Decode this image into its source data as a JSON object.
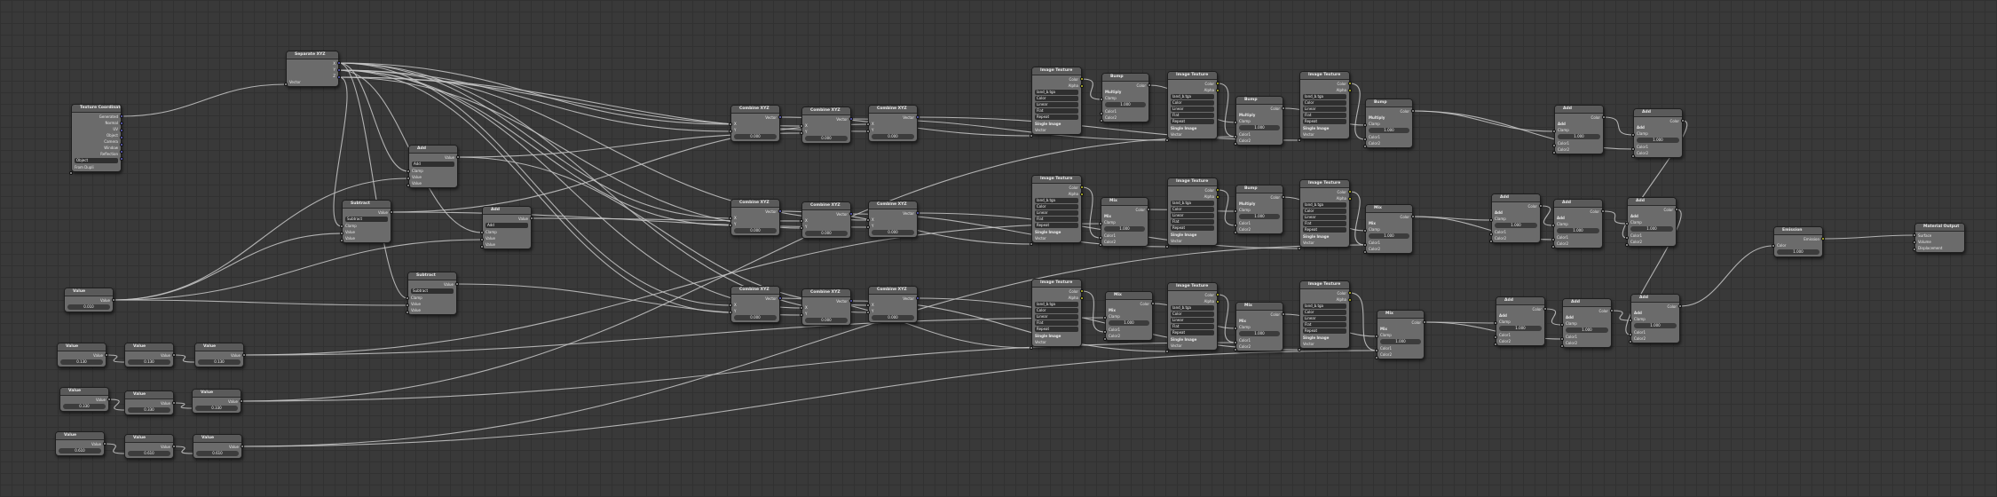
{
  "node_editor": {
    "colors": {
      "background": "#393939",
      "grid": "#313131",
      "wire": "#c8c8c8",
      "node_body": "#6b6b6b",
      "node_header": "#5a5a5a",
      "socket_vector": "#6363c7",
      "socket_color": "#c7c729",
      "socket_float": "#a1a1a1"
    },
    "labels": {
      "texcoord": "Texture Coordinate",
      "sepxyz": "Separate XYZ",
      "combxyz": "Combine XYZ",
      "imgtex": "Image Texture",
      "mix": "Mix",
      "bump": "Bump",
      "add": "Add",
      "subtract": "Subtract",
      "value": "Value",
      "vector": "Vector",
      "color": "Color",
      "alpha": "Alpha",
      "clamp": "Clamp",
      "fac": "Fac",
      "color1": "Color1",
      "color2": "Color2",
      "multiply": "Multiply",
      "relative_lbl": "Relative",
      "normal": "Normal",
      "linear": "Linear",
      "flat": "Flat",
      "repeat": "Repeat",
      "single_image": "Single Image",
      "generated": "Generated",
      "uv": "UV",
      "object": "Object",
      "camera": "Camera",
      "window": "Window",
      "reflection": "Reflection",
      "from_dupli": "From Dupli",
      "x": "X",
      "y": "Y",
      "z": "Z",
      "material_output": "Material Output",
      "surface": "Surface",
      "volume": "Volume",
      "displacement": "Displacement",
      "emission": "Emission",
      "strength": "Strength"
    },
    "values": {
      "zero": "0.000",
      "one": "1.000",
      "scale": "0.010",
      "offset_a": "0.130",
      "offset_b": "0.330",
      "offset_c": "0.610",
      "fac": "1.000",
      "strength": "1.000",
      "color_space": "Color",
      "image": "land_b.tga"
    }
  }
}
